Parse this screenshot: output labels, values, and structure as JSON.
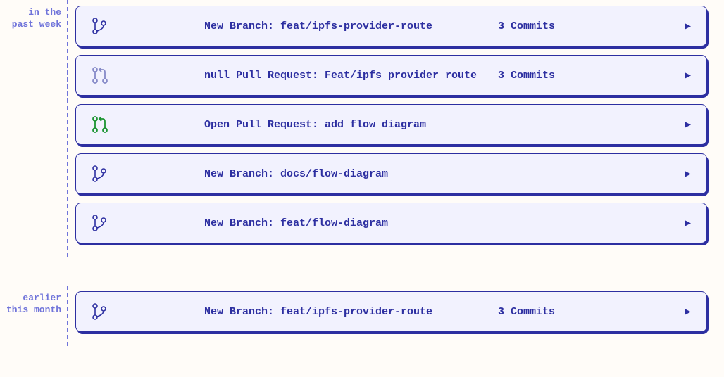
{
  "groups": [
    {
      "label": "in the\npast week",
      "cards": [
        {
          "icon": "branch",
          "title": "New Branch: feat/ipfs-provider-route",
          "commits": "3 Commits"
        },
        {
          "icon": "pr-null",
          "title": "null Pull Request: Feat/ipfs provider route",
          "commits": "3 Commits"
        },
        {
          "icon": "pr-open",
          "title": "Open Pull Request: add flow diagram",
          "commits": ""
        },
        {
          "icon": "branch",
          "title": "New Branch: docs/flow-diagram",
          "commits": ""
        },
        {
          "icon": "branch",
          "title": "New Branch: feat/flow-diagram",
          "commits": ""
        }
      ]
    },
    {
      "label": "earlier\nthis month",
      "cards": [
        {
          "icon": "branch",
          "title": "New Branch: feat/ipfs-provider-route",
          "commits": "3 Commits"
        }
      ]
    }
  ]
}
